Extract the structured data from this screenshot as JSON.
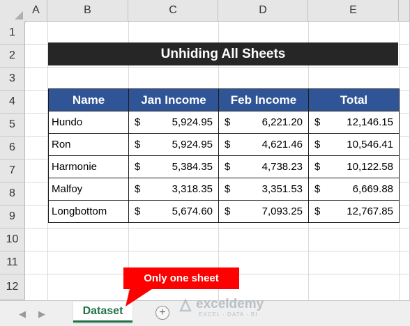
{
  "columns": [
    "A",
    "B",
    "C",
    "D",
    "E"
  ],
  "rows": [
    "1",
    "2",
    "3",
    "4",
    "5",
    "6",
    "7",
    "8",
    "9",
    "10",
    "11",
    "12"
  ],
  "title": "Unhiding All Sheets",
  "table": {
    "headers": [
      "Name",
      "Jan Income",
      "Feb Income",
      "Total"
    ],
    "rows": [
      {
        "name": "Hundo",
        "jan": "5,924.95",
        "feb": "6,221.20",
        "total": "12,146.15"
      },
      {
        "name": "Ron",
        "jan": "5,924.95",
        "feb": "4,621.46",
        "total": "10,546.41"
      },
      {
        "name": "Harmonie",
        "jan": "5,384.35",
        "feb": "4,738.23",
        "total": "10,122.58"
      },
      {
        "name": "Malfoy",
        "jan": "3,318.35",
        "feb": "3,351.53",
        "total": "6,669.88"
      },
      {
        "name": "Longbottom",
        "jan": "5,674.60",
        "feb": "7,093.25",
        "total": "12,767.85"
      }
    ],
    "currency": "$"
  },
  "sheet_tab": "Dataset",
  "add_sheet": "+",
  "callout": "Only one sheet",
  "brand": {
    "name": "exceldemy",
    "tagline": "EXCEL · DATA · BI"
  },
  "colors": {
    "title_bg": "#262626",
    "header_bg": "#2f5597",
    "tab_accent": "#217346",
    "callout_bg": "#ff0000"
  }
}
